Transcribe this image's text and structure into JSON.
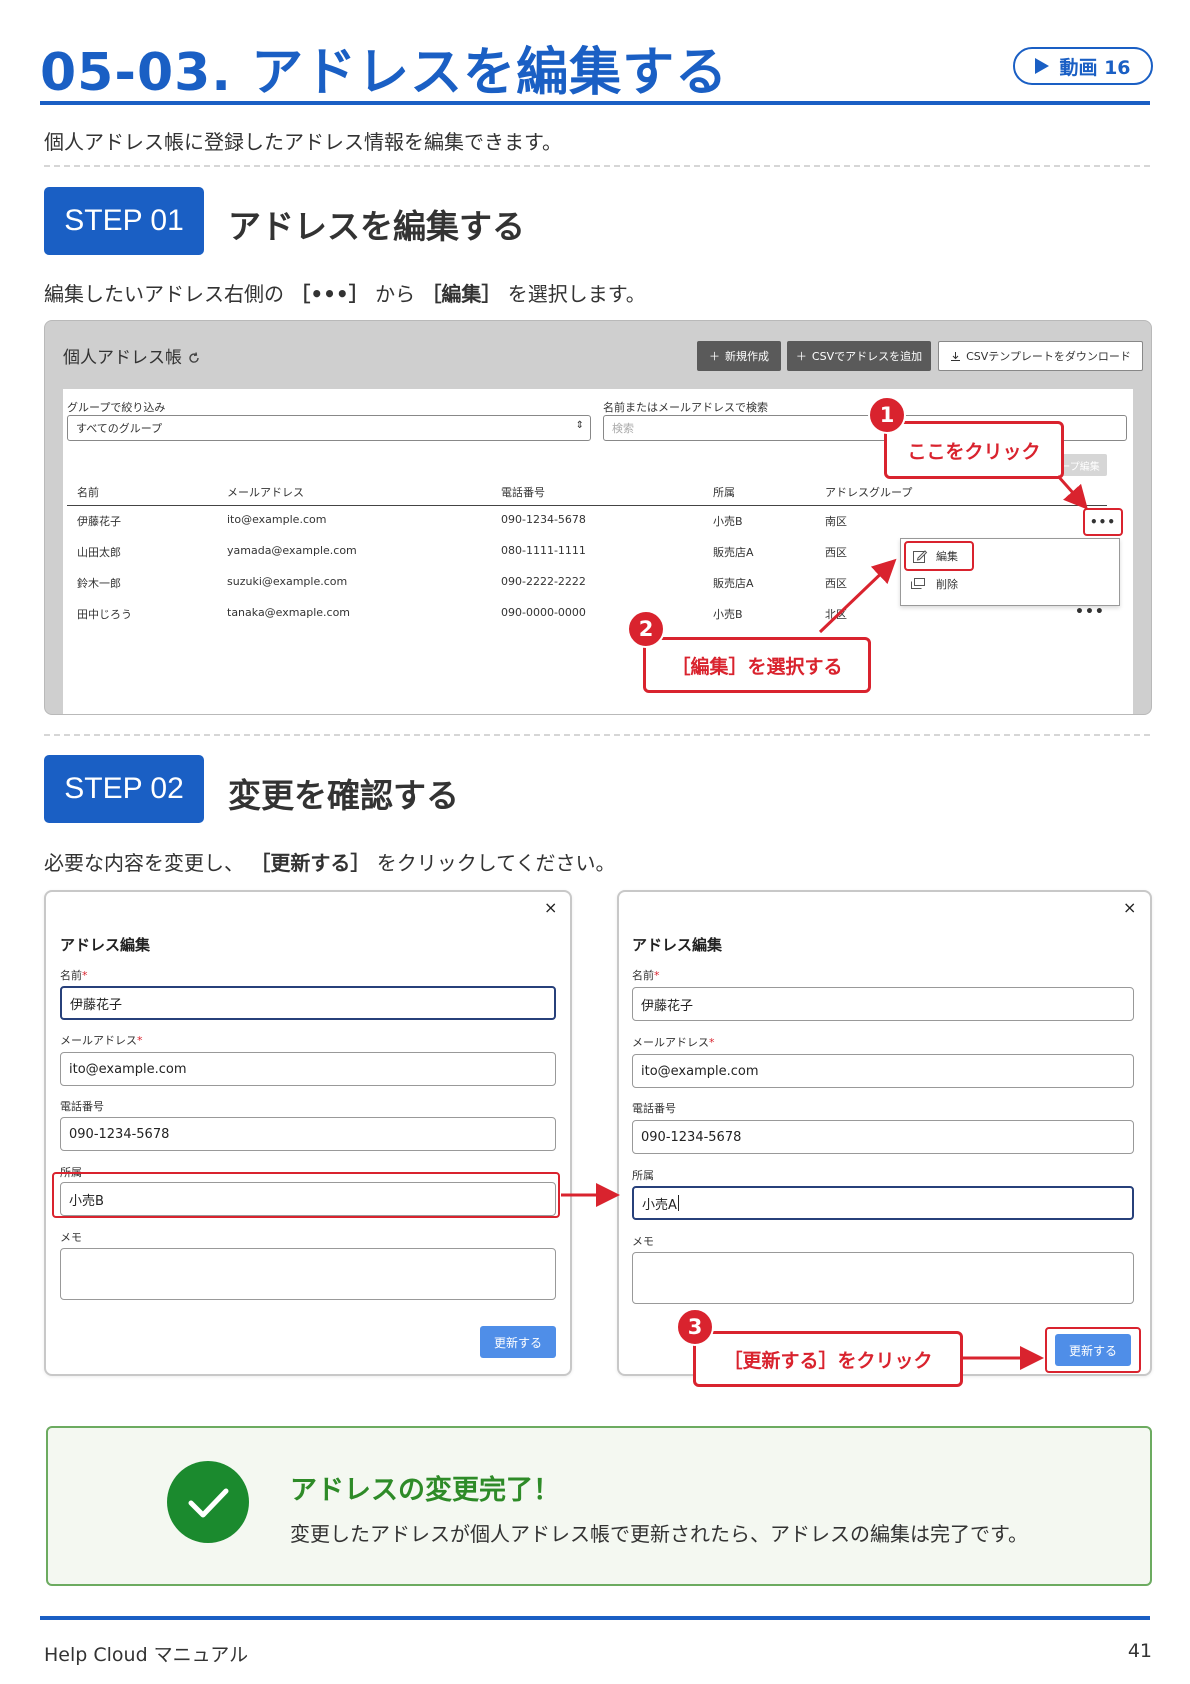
{
  "header": {
    "title": "05-03. アドレスを編集する",
    "video_badge": "動画 16",
    "intro": "個人アドレス帳に登録したアドレス情報を編集できます。"
  },
  "step1": {
    "badge": "STEP 01",
    "title": "アドレスを編集する",
    "desc_pre": "編集したいアドレス右側の",
    "desc_key1": "［•••］",
    "desc_mid": "から",
    "desc_key2": "［編集］",
    "desc_post": "を選択します。"
  },
  "screenshot1": {
    "title": "個人アドレス帳",
    "buttons": {
      "new": "新規作成",
      "csv_add": "CSVでアドレスを追加",
      "csv_template": "CSVテンプレートをダウンロード"
    },
    "group_filter_label": "グループで絞り込み",
    "group_filter_value": "すべてのグループ",
    "search_label": "名前またはメールアドレスで検索",
    "search_placeholder": "検索",
    "group_edit_button": "ループ編集",
    "columns": [
      "名前",
      "メールアドレス",
      "電話番号",
      "所属",
      "アドレスグループ"
    ],
    "rows": [
      {
        "name": "伊藤花子",
        "email": "ito@example.com",
        "phone": "090-1234-5678",
        "org": "小売B",
        "group": "南区"
      },
      {
        "name": "山田太郎",
        "email": "yamada@example.com",
        "phone": "080-1111-1111",
        "org": "販売店A",
        "group": "西区"
      },
      {
        "name": "鈴木一郎",
        "email": "suzuki@example.com",
        "phone": "090-2222-2222",
        "org": "販売店A",
        "group": "西区"
      },
      {
        "name": "田中じろう",
        "email": "tanaka@exmaple.com",
        "phone": "090-0000-0000",
        "org": "小売B",
        "group": "北区"
      }
    ],
    "more": "•••",
    "menu": {
      "edit": "編集",
      "delete": "削除"
    },
    "callout1_num": "1",
    "callout1_text": "ここをクリック",
    "callout2_num": "2",
    "callout2_text": "［編集］を選択する"
  },
  "step2": {
    "badge": "STEP 02",
    "title": "変更を確認する",
    "desc_pre": "必要な内容を変更し、",
    "desc_key": "［更新する］",
    "desc_post": "をクリックしてください。"
  },
  "dialog": {
    "close": "×",
    "title": "アドレス編集",
    "name_label": "名前",
    "email_label": "メールアドレス",
    "phone_label": "電話番号",
    "org_label": "所属",
    "memo_label": "メモ",
    "required_mark": "*",
    "name": "伊藤花子",
    "email": "ito@example.com",
    "phone": "090-1234-5678",
    "org_before": "小売B",
    "org_after": "小売A",
    "update_button": "更新する",
    "callout3_num": "3",
    "callout3_text": "［更新する］をクリック"
  },
  "done": {
    "title": "アドレスの変更完了！",
    "text": "変更したアドレスが個人アドレス帳で更新されたら、アドレスの編集は完了です。"
  },
  "footer": {
    "left": "Help Cloud マニュアル",
    "page": "41"
  },
  "colors": {
    "brand_blue": "#1a5fc4",
    "callout_red": "#d9232e",
    "success_green": "#1b8a2e",
    "button_blue": "#4f8ee8"
  },
  "icons": [
    "play-icon",
    "plus-icon",
    "download-icon",
    "refresh-icon",
    "select-arrow-icon",
    "edit-icon",
    "delete-icon",
    "close-icon",
    "check-icon",
    "arrow-icon"
  ]
}
